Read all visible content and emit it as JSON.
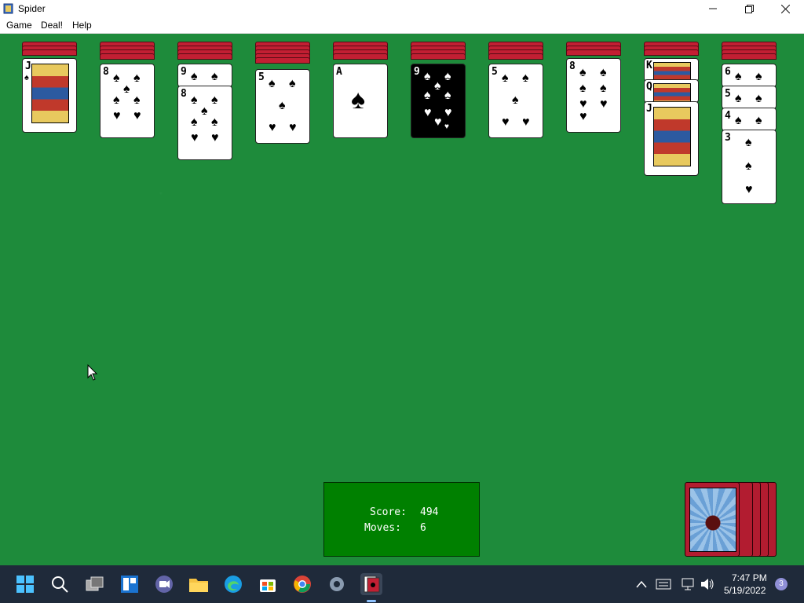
{
  "window": {
    "title": "Spider",
    "minimize": "—",
    "restore": "❐",
    "close": "✕"
  },
  "menu": [
    "Game",
    "Deal!",
    "Help"
  ],
  "tableau": [
    {
      "rank": "J",
      "suit": "♠",
      "type": "face"
    },
    {
      "rank": "8",
      "suit": "♠",
      "type": "pip"
    },
    {
      "rank": "9",
      "suit": "♠",
      "type": "pip",
      "under": "8"
    },
    {
      "rank": "5",
      "suit": "♠",
      "type": "pip"
    },
    {
      "rank": "A",
      "suit": "♠",
      "type": "ace"
    },
    {
      "rank": "9",
      "suit": "♠",
      "type": "pip",
      "selected": true
    },
    {
      "rank": "5",
      "suit": "♠",
      "type": "pip"
    },
    {
      "rank": "8",
      "suit": "♠",
      "type": "pip"
    },
    {
      "rank": "K",
      "suit": "♠",
      "type": "face",
      "run": [
        "K",
        "Q",
        "J"
      ]
    },
    {
      "rank": "6",
      "suit": "♠",
      "type": "pip",
      "run": [
        "6",
        "5",
        "4",
        "3"
      ]
    }
  ],
  "status": {
    "score_label": "Score:",
    "score_value": "494",
    "moves_label": "Moves:",
    "moves_value": "6"
  },
  "stock": {
    "remaining_deals": 4
  },
  "taskbar": {
    "time": "7:47 PM",
    "date": "5/19/2022",
    "notification_count": "3"
  },
  "colors": {
    "felt": "#1e8b3b",
    "card_back": "#c21f33",
    "status_box": "#008000",
    "taskbar": "#1f2a3a"
  }
}
